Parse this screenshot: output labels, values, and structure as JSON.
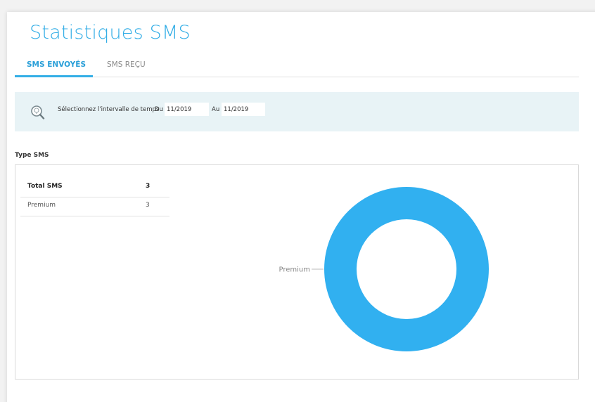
{
  "page": {
    "title": "Statistiques SMS"
  },
  "tabs": [
    {
      "label": "SMS ENVOYÉS",
      "active": true
    },
    {
      "label": "SMS REÇU",
      "active": false
    }
  ],
  "filter": {
    "label": "Sélectionnez l'intervalle de temps :",
    "from_prefix": "Du",
    "from_value": "11/2019",
    "to_prefix": "Au",
    "to_value": "11/2019",
    "icon": "search-icon"
  },
  "section": {
    "title": "Type SMS"
  },
  "stats_table": {
    "total_label": "Total SMS",
    "total_value": "3",
    "rows": [
      {
        "label": "Premium",
        "value": "3"
      }
    ]
  },
  "chart_data": {
    "type": "pie",
    "style": "donut",
    "categories": [
      "Premium"
    ],
    "values": [
      3
    ],
    "colors": [
      "#31b0f0"
    ],
    "labels_outside": true
  },
  "colors": {
    "accent": "#34aee6",
    "filter_background": "#e8f3f6",
    "donut": "#31b0f0"
  }
}
